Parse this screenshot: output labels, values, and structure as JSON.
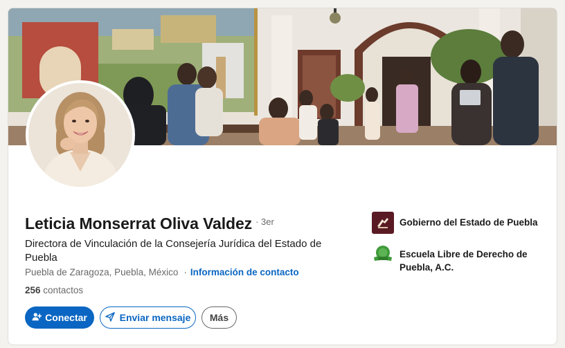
{
  "profile": {
    "name": "Leticia Monserrat Oliva Valdez",
    "degree": "· 3er",
    "headline": "Directora de Vinculación de la Consejería Jurídica del Estado de Puebla",
    "location": "Puebla de Zaragoza, Puebla, México",
    "separator": "·",
    "contact_info_label": "Información de contacto",
    "connections_count": "256",
    "connections_label": "contactos"
  },
  "actions": {
    "connect_label": "Conectar",
    "message_label": "Enviar mensaje",
    "more_label": "Más"
  },
  "organizations": [
    {
      "name": "Gobierno del Estado de Puebla",
      "logo": "gobierno-puebla-logo",
      "color": "#5a1a24"
    },
    {
      "name": "Escuela Libre de Derecho de Puebla, A.C.",
      "logo": "escuela-libre-derecho-logo",
      "color": "#3f9a3a"
    }
  ],
  "colors": {
    "primary": "#0a66c2",
    "background": "#f4f2ee"
  },
  "icons": {
    "connect": "person-add-icon",
    "message": "send-icon"
  }
}
